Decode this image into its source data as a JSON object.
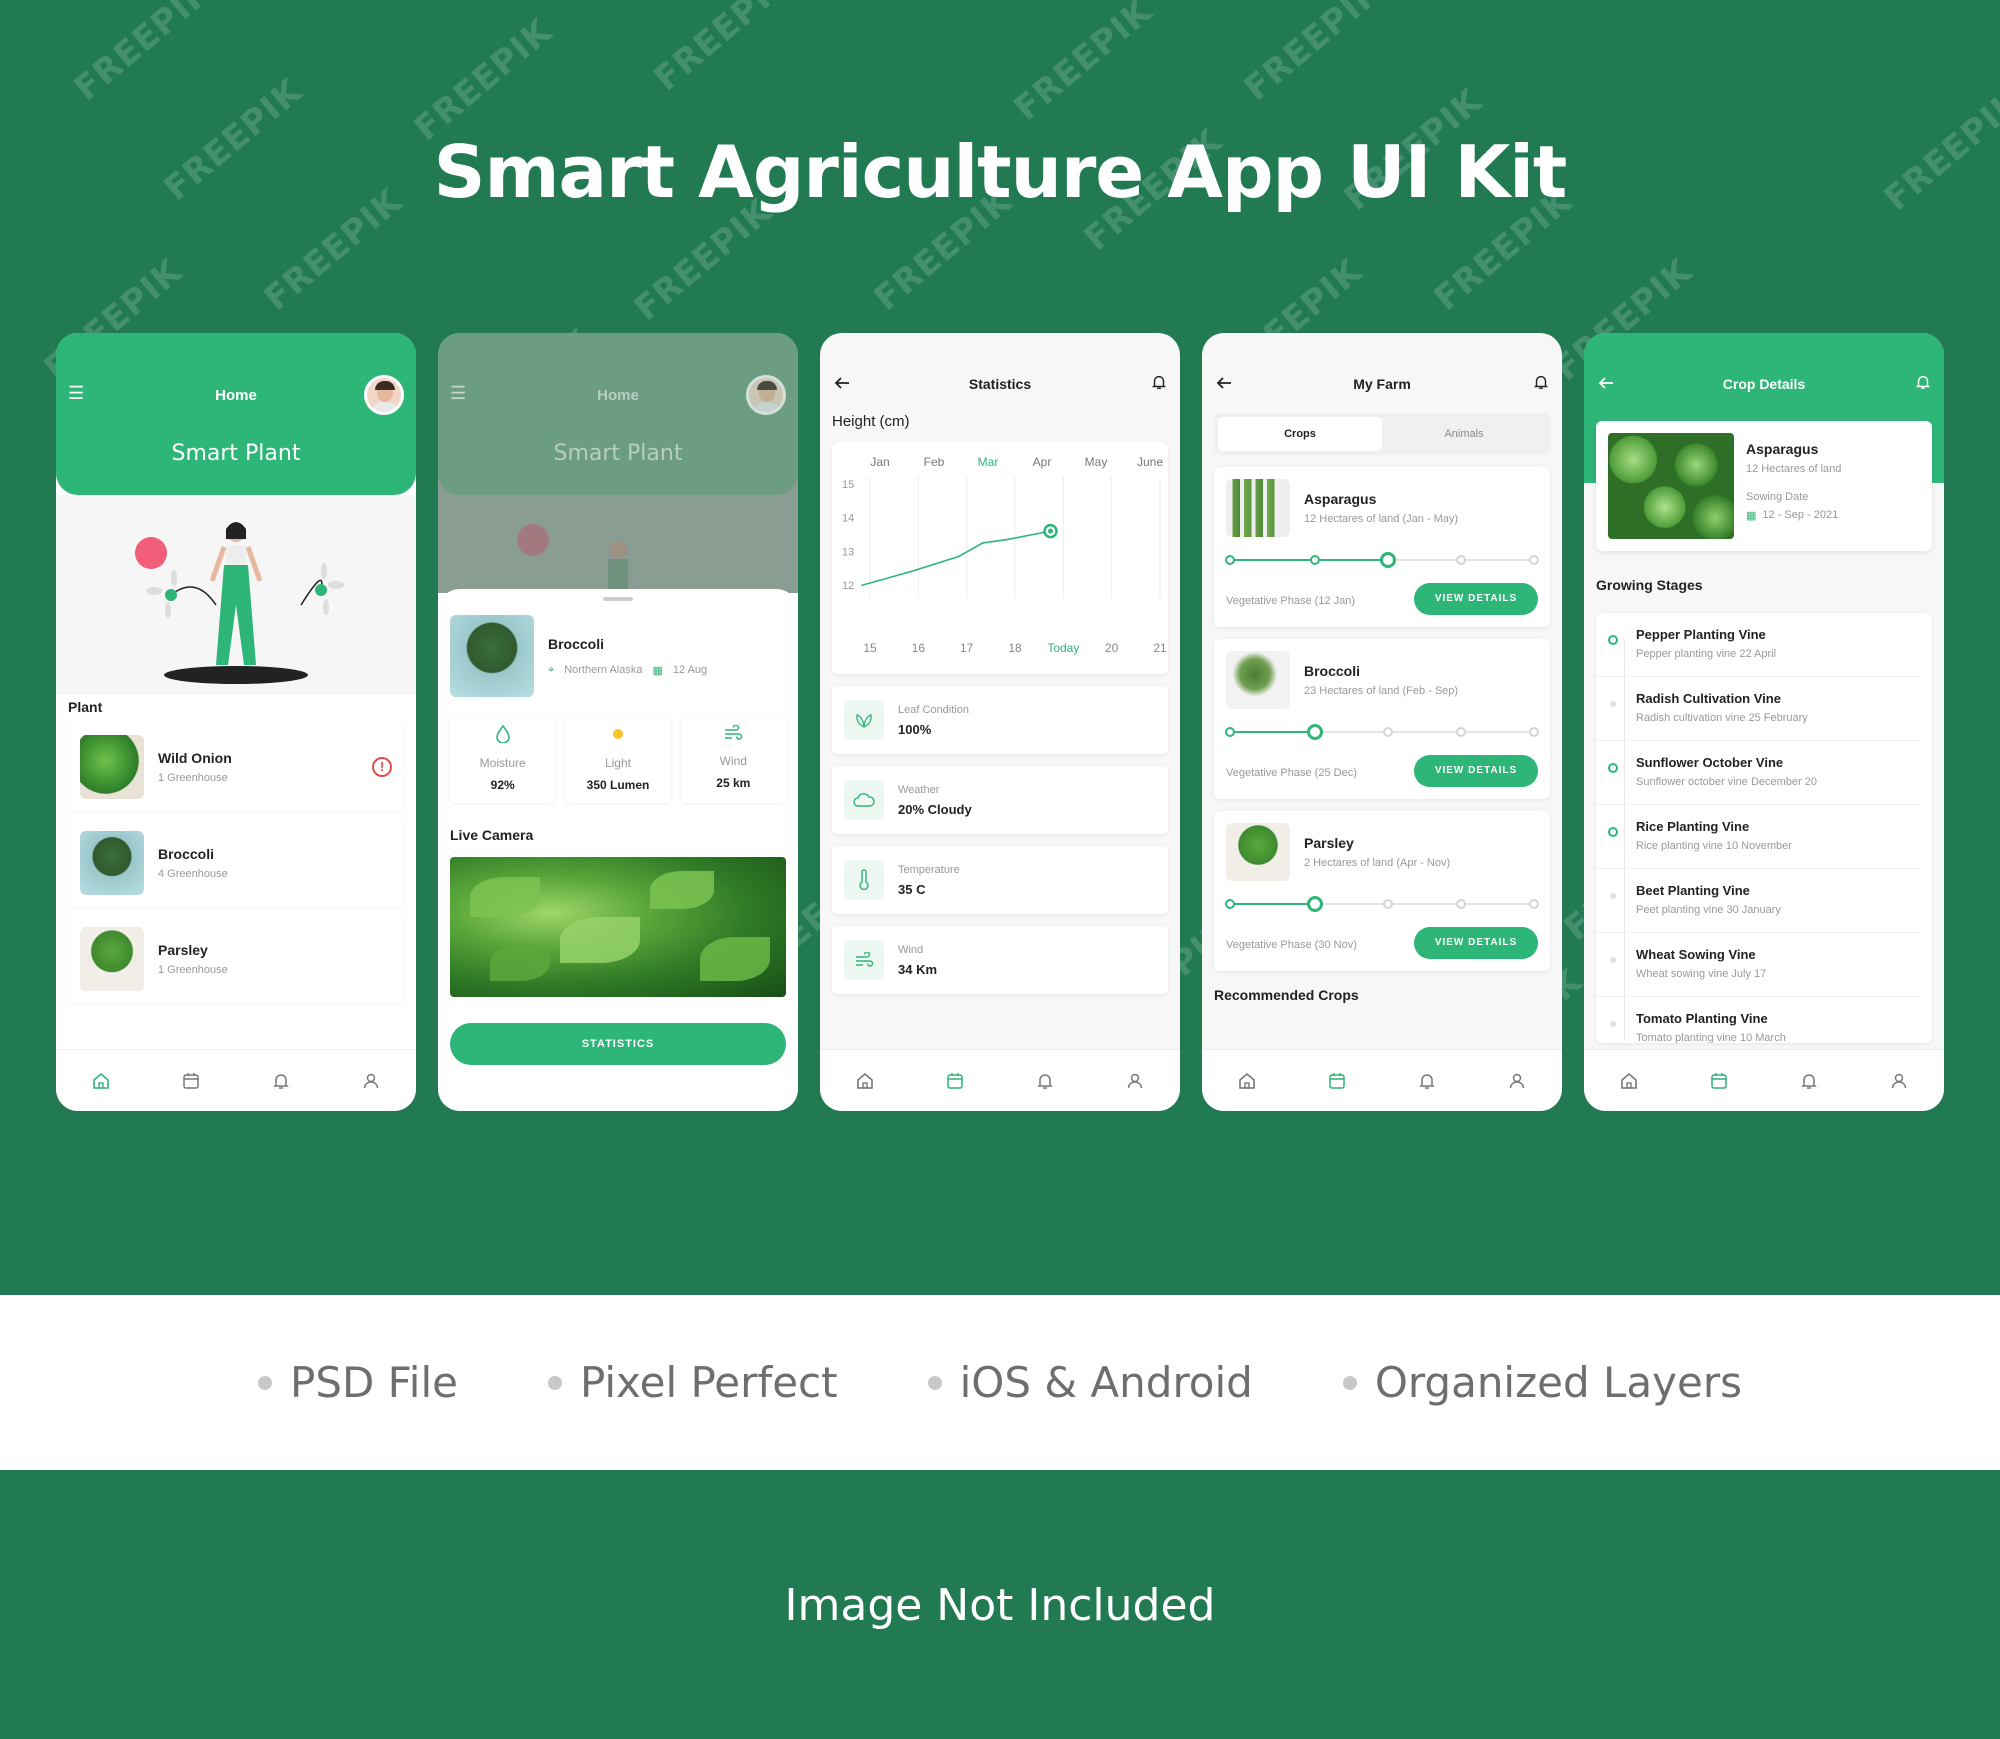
{
  "title": "Smart Agriculture App UI Kit",
  "features": [
    "PSD File",
    "Pixel Perfect",
    "iOS & Android",
    "Organized Layers"
  ],
  "footer_note": "Image Not Included",
  "watermark": "FREEPIK",
  "colors": {
    "brand_green": "#2eb578",
    "background_green": "#217a52",
    "alert_red": "#e54b4b"
  },
  "screen_home": {
    "header_title": "Home",
    "header_subtitle": "Smart Plant",
    "section_label": "Plant",
    "plants": [
      {
        "name": "Wild Onion",
        "sub": "1 Greenhouse",
        "alert": "!"
      },
      {
        "name": "Broccoli",
        "sub": "4 Greenhouse"
      },
      {
        "name": "Parsley",
        "sub": "1 Greenhouse"
      }
    ]
  },
  "screen_detail": {
    "header_title": "Home",
    "header_subtitle": "Smart Plant",
    "plant_name": "Broccoli",
    "location": "Northern Alaska",
    "date": "12 Aug",
    "sensors": [
      {
        "label": "Moisture",
        "value": "92%",
        "icon": "drop-icon"
      },
      {
        "label": "Light",
        "value": "350 Lumen",
        "icon": "sun-icon"
      },
      {
        "label": "Wind",
        "value": "25 km",
        "icon": "wind-icon"
      }
    ],
    "live_camera_label": "Live Camera",
    "button_label": "STATISTICS"
  },
  "screen_stats": {
    "title": "Statistics",
    "chart_heading": "Height (cm)",
    "chart_data": {
      "type": "line",
      "months": [
        "Jan",
        "Feb",
        "Mar",
        "Apr",
        "May",
        "June"
      ],
      "active_month": "Mar",
      "x": [
        "15",
        "16",
        "17",
        "18",
        "Today",
        "20",
        "21"
      ],
      "active_x": "Today",
      "y_ticks": [
        "15",
        "14",
        "13",
        "12"
      ],
      "ylim": [
        11.8,
        15.2
      ],
      "points": [
        {
          "x": 0.0,
          "y": 12.0
        },
        {
          "x": 1.0,
          "y": 12.4
        },
        {
          "x": 2.0,
          "y": 12.85
        },
        {
          "x": 2.5,
          "y": 13.25
        },
        {
          "x": 3.0,
          "y": 13.35
        },
        {
          "x": 3.9,
          "y": 13.6
        }
      ],
      "grid": true
    },
    "info": [
      {
        "label": "Leaf Condition",
        "value": "100%",
        "icon": "leaf-icon"
      },
      {
        "label": "Weather",
        "value": "20% Cloudy",
        "icon": "cloud-icon"
      },
      {
        "label": "Temperature",
        "value": "35 C",
        "icon": "thermometer-icon"
      },
      {
        "label": "Wind",
        "value": "34 Km",
        "icon": "wind-icon"
      }
    ]
  },
  "screen_farm": {
    "title": "My Farm",
    "tabs": [
      "Crops",
      "Animals"
    ],
    "active_tab": "Crops",
    "crops": [
      {
        "name": "Asparagus",
        "sub": "12 Hectares of land (Jan - May)",
        "phase": "Vegetative Phase (12 Jan)",
        "progress": 0.52
      },
      {
        "name": "Broccoli",
        "sub": "23 Hectares of land (Feb - Sep)",
        "phase": "Vegetative Phase (25 Dec)",
        "progress": 0.28
      },
      {
        "name": "Parsley",
        "sub": "2 Hectares of land (Apr - Nov)",
        "phase": "Vegetative Phase (30 Nov)",
        "progress": 0.28
      }
    ],
    "button_label": "VIEW DETAILS",
    "recommended_label": "Recommended Crops"
  },
  "screen_crop": {
    "title": "Crop Details",
    "crop_name": "Asparagus",
    "crop_sub": "12 Hectares of land",
    "sowing_label": "Sowing Date",
    "sowing_date": "12 - Sep - 2021",
    "stages_label": "Growing Stages",
    "stages": [
      {
        "name": "Pepper Planting Vine",
        "sub": "Pepper planting vine 22 April",
        "done": true
      },
      {
        "name": "Radish Cultivation Vine",
        "sub": "Radish cultivation vine 25 February",
        "done": false
      },
      {
        "name": "Sunflower October Vine",
        "sub": "Sunflower october vine December 20",
        "done": true
      },
      {
        "name": "Rice Planting Vine",
        "sub": "Rice planting vine 10 November",
        "done": true
      },
      {
        "name": "Beet Planting Vine",
        "sub": "Peet planting vine 30 January",
        "done": false
      },
      {
        "name": "Wheat Sowing Vine",
        "sub": "Wheat sowing vine July 17",
        "done": false
      },
      {
        "name": "Tomato Planting Vine",
        "sub": "Tomato planting vine 10 March",
        "done": false
      }
    ]
  }
}
